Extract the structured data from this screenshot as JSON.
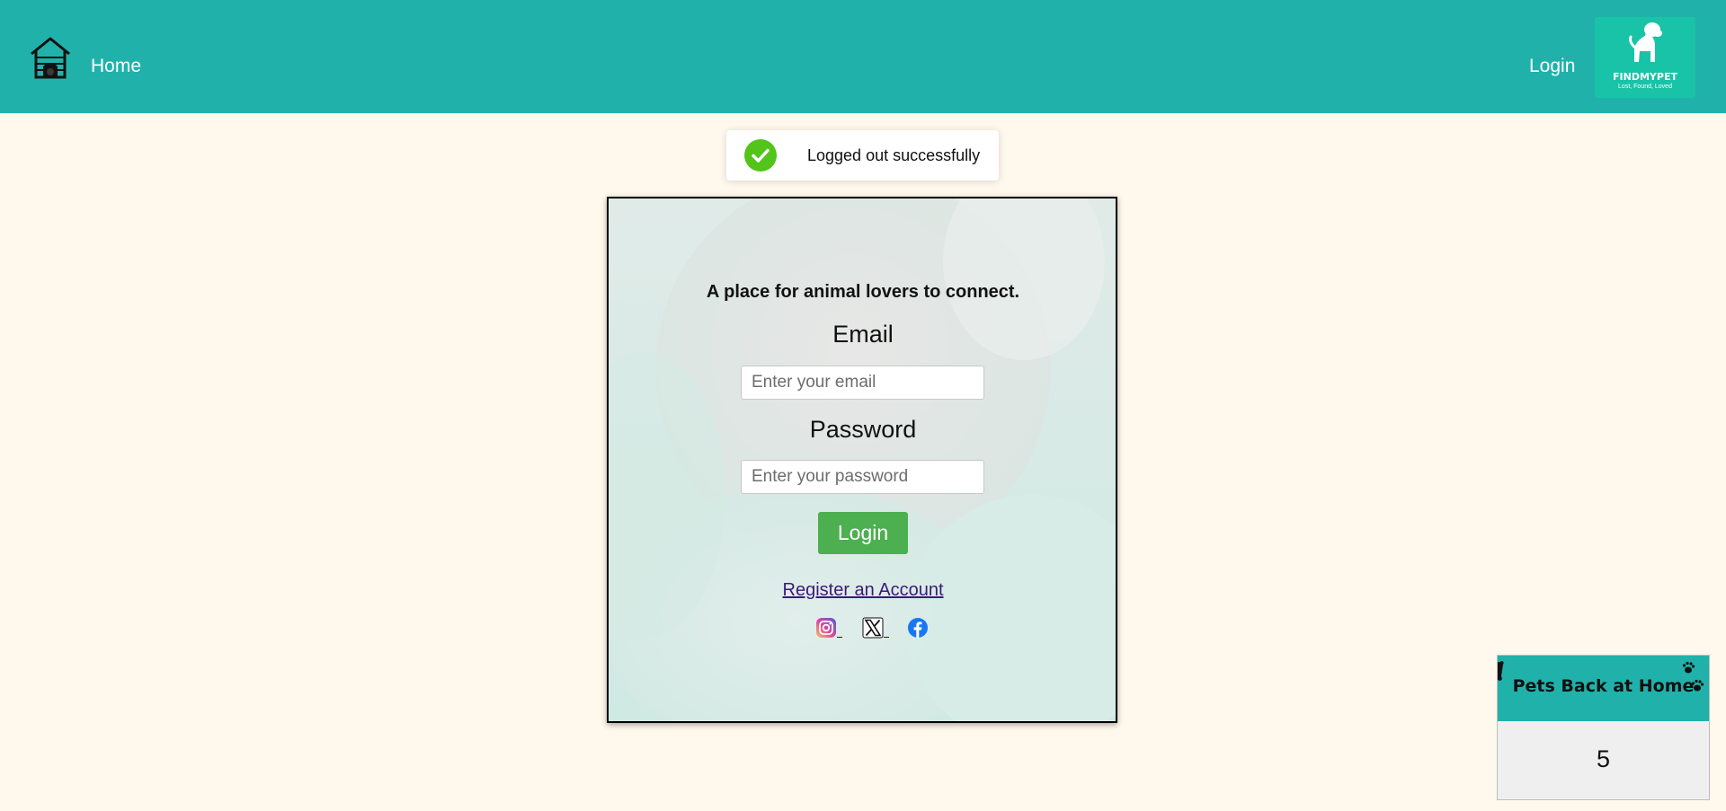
{
  "navbar": {
    "home_label": "Home",
    "login_label": "Login",
    "logo": {
      "name": "FINDMYPET",
      "tagline": "Lost, Found, Loved"
    }
  },
  "toast": {
    "message": "Logged out successfully",
    "status": "success",
    "status_color": "#52c41a"
  },
  "login_form": {
    "tagline": "A place for animal lovers to connect.",
    "email_label": "Email",
    "email_placeholder": "Enter your email",
    "email_value": "",
    "password_label": "Password",
    "password_placeholder": "Enter your password",
    "password_value": "",
    "submit_label": "Login",
    "register_label": "Register an Account",
    "social_links": [
      {
        "icon": "instagram-icon"
      },
      {
        "icon": "x-icon"
      },
      {
        "icon": "facebook-icon"
      }
    ]
  },
  "counter_widget": {
    "title": "Pets Back at Home",
    "value": "5"
  },
  "colors": {
    "accent": "#20b2aa",
    "page_background": "#fff8ec",
    "login_button": "#4caf50",
    "logo_background": "#19c3a8",
    "link": "#3a1a78"
  }
}
